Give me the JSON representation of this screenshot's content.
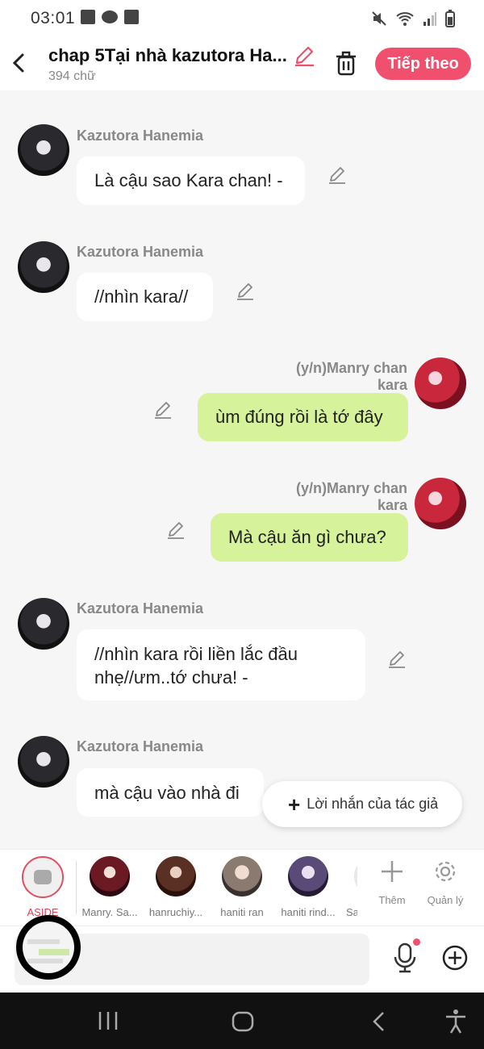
{
  "status_bar": {
    "time": "03:01"
  },
  "header": {
    "title": "chap 5Tại nhà kazutora Ha...",
    "word_count": "394 chữ",
    "next_button": "Tiếp theo"
  },
  "messages": [
    {
      "side": "in",
      "sender": "Kazutora Hanemia",
      "lines": [
        "Là cậu sao Kara chan! -"
      ]
    },
    {
      "side": "in",
      "sender": "Kazutora Hanemia",
      "lines": [
        "//nhìn kara//"
      ]
    },
    {
      "side": "out",
      "sender": "(y/n)Manry chan kara",
      "lines": [
        "ùm đúng rồi là tớ đây"
      ]
    },
    {
      "side": "out",
      "sender": "(y/n)Manry chan kara",
      "lines": [
        "Mà cậu ăn gì chưa?"
      ]
    },
    {
      "side": "in",
      "sender": "Kazutora Hanemia",
      "lines": [
        "//nhìn kara rồi liền lắc đầu",
        "nhẹ//ưm..tớ chưa! -"
      ]
    },
    {
      "side": "in",
      "sender": "Kazutora Hanemia",
      "lines": [
        "mà cậu vào nhà đi"
      ]
    }
  ],
  "author_note_button": "Lời nhắn của tác giả",
  "characters": [
    {
      "name": "ASIDE"
    },
    {
      "name": "Manry. Sa..."
    },
    {
      "name": "hanruchiy..."
    },
    {
      "name": "haniti ran"
    },
    {
      "name": "haniti rind..."
    },
    {
      "name": "Sa"
    }
  ],
  "tools": {
    "add": "Thêm",
    "manage": "Quản lý"
  },
  "colors": {
    "accent": "#f0506e",
    "outgoing_bubble": "#d6f29a",
    "incoming_bubble": "#ffffff"
  }
}
